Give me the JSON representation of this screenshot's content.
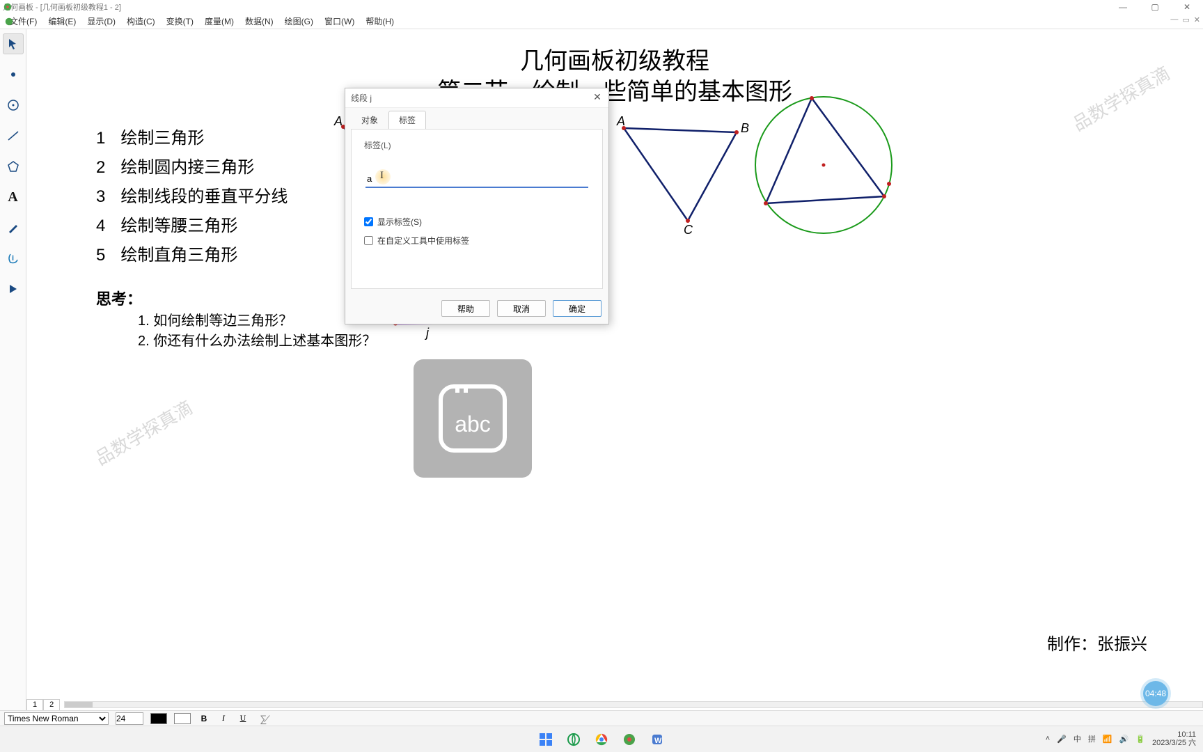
{
  "window": {
    "title": "几何画板 - [几何画板初级教程1 - 2]"
  },
  "menu": {
    "items": [
      "文件(F)",
      "编辑(E)",
      "显示(D)",
      "构造(C)",
      "变换(T)",
      "度量(M)",
      "数据(N)",
      "绘图(G)",
      "窗口(W)",
      "帮助(H)"
    ]
  },
  "content": {
    "title1": "几何画板初级教程",
    "title2": "第二节　绘制一些简单的基本图形",
    "list": [
      {
        "n": "1",
        "t": "绘制三角形"
      },
      {
        "n": "2",
        "t": "绘制圆内接三角形"
      },
      {
        "n": "3",
        "t": "绘制线段的垂直平分线"
      },
      {
        "n": "4",
        "t": "绘制等腰三角形"
      },
      {
        "n": "5",
        "t": "绘制直角三角形"
      }
    ],
    "think_h": "思考：",
    "think_q1": "1. 如何绘制等边三角形？",
    "think_q2": "2. 你还有什么办法绘制上述基本图形？",
    "author": "制作：张振兴",
    "watermark": "品数学探真滴",
    "labels": {
      "A": "A",
      "B": "B",
      "C": "C",
      "A2": "A",
      "B2": "B",
      "j": "j"
    }
  },
  "dialog": {
    "title": "线段 j",
    "tab_object": "对象",
    "tab_label": "标签",
    "field_label": "标签(L)",
    "input_value": "a",
    "chk_show": "显示标签(S)",
    "chk_custom": "在自定义工具中使用标签",
    "btn_help": "帮助",
    "btn_cancel": "取消",
    "btn_ok": "确定"
  },
  "ime": {
    "text": "abc"
  },
  "format": {
    "font": "Times New Roman",
    "size": "24"
  },
  "pages": {
    "p1": "1",
    "p2": "2"
  },
  "tray": {
    "ime1": "中",
    "ime2": "拼",
    "time": "10:11",
    "date": "2023/3/25",
    "day": "六"
  },
  "rec": {
    "time": "04:48"
  }
}
